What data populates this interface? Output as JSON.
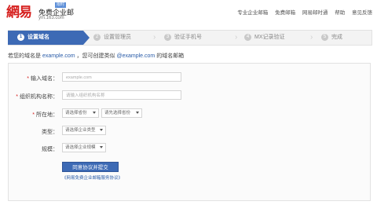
{
  "header": {
    "logo_mark": "網易",
    "logo_product": "免费企业邮",
    "logo_domain": "ym.163.com",
    "logo_badge": "限时",
    "nav": [
      "专业企业邮箱",
      "免费邮箱",
      "网易邮时通",
      "帮助",
      "意见反馈"
    ]
  },
  "steps": [
    {
      "label": "设置域名",
      "state": "active"
    },
    {
      "label": "设置管理员",
      "state": "pending"
    },
    {
      "label": "验证手机号",
      "state": "pending"
    },
    {
      "label": "MX记录验证",
      "state": "pending"
    },
    {
      "label": "完成",
      "state": "pending"
    }
  ],
  "hint": {
    "prefix": "若您的域名是",
    "domain": "example.com",
    "middle": "，您可创建类似",
    "email": "@example.com",
    "suffix": "的域名邮箱"
  },
  "form": {
    "domain": {
      "label": "输入域名：",
      "placeholder": "example.com",
      "required": true
    },
    "org": {
      "label": "组织机构名称：",
      "placeholder": "请输入组织机构名称",
      "required": true
    },
    "location": {
      "label": "所在地：",
      "province": "请选择省份",
      "city": "请先选择省份",
      "required": true
    },
    "type": {
      "label": "类型：",
      "value": "请选择企业类型"
    },
    "scale": {
      "label": "规模：",
      "value": "请选择企业规模"
    },
    "submit_label": "同意协议并提交",
    "agreement_text": "《网易免费企业邮箱服务协议》"
  },
  "colors": {
    "brand": "#d6211f",
    "accent": "#3d6ab5"
  }
}
